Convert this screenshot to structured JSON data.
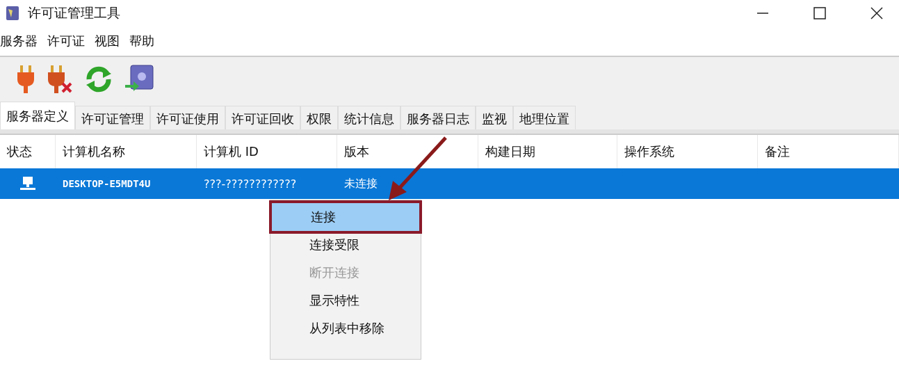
{
  "window": {
    "title": "许可证管理工具"
  },
  "menu_bar": [
    "服务器",
    "许可证",
    "视图",
    "帮助"
  ],
  "tabs": [
    {
      "label": "服务器定义",
      "selected": true
    },
    {
      "label": "许可证管理",
      "selected": false
    },
    {
      "label": "许可证使用",
      "selected": false
    },
    {
      "label": "许可证回收",
      "selected": false
    },
    {
      "label": "权限",
      "selected": false
    },
    {
      "label": "统计信息",
      "selected": false
    },
    {
      "label": "服务器日志",
      "selected": false
    },
    {
      "label": "监视",
      "selected": false
    },
    {
      "label": "地理位置",
      "selected": false
    }
  ],
  "table": {
    "columns": [
      "状态",
      "计算机名称",
      "计算机 ID",
      "版本",
      "构建日期",
      "操作系统",
      "备注"
    ],
    "rows": [
      {
        "selected": true,
        "name": "DESKTOP-E5MDT4U",
        "id": "???-????????????",
        "version": "未连接"
      }
    ]
  },
  "context_menu": [
    {
      "label": "连接",
      "selected": true,
      "disabled": false
    },
    {
      "label": "连接受限",
      "selected": false,
      "disabled": false
    },
    {
      "label": "断开连接",
      "selected": false,
      "disabled": true
    },
    {
      "label": "显示特性",
      "selected": false,
      "disabled": false
    },
    {
      "label": "从列表中移除",
      "selected": false,
      "disabled": false
    }
  ]
}
